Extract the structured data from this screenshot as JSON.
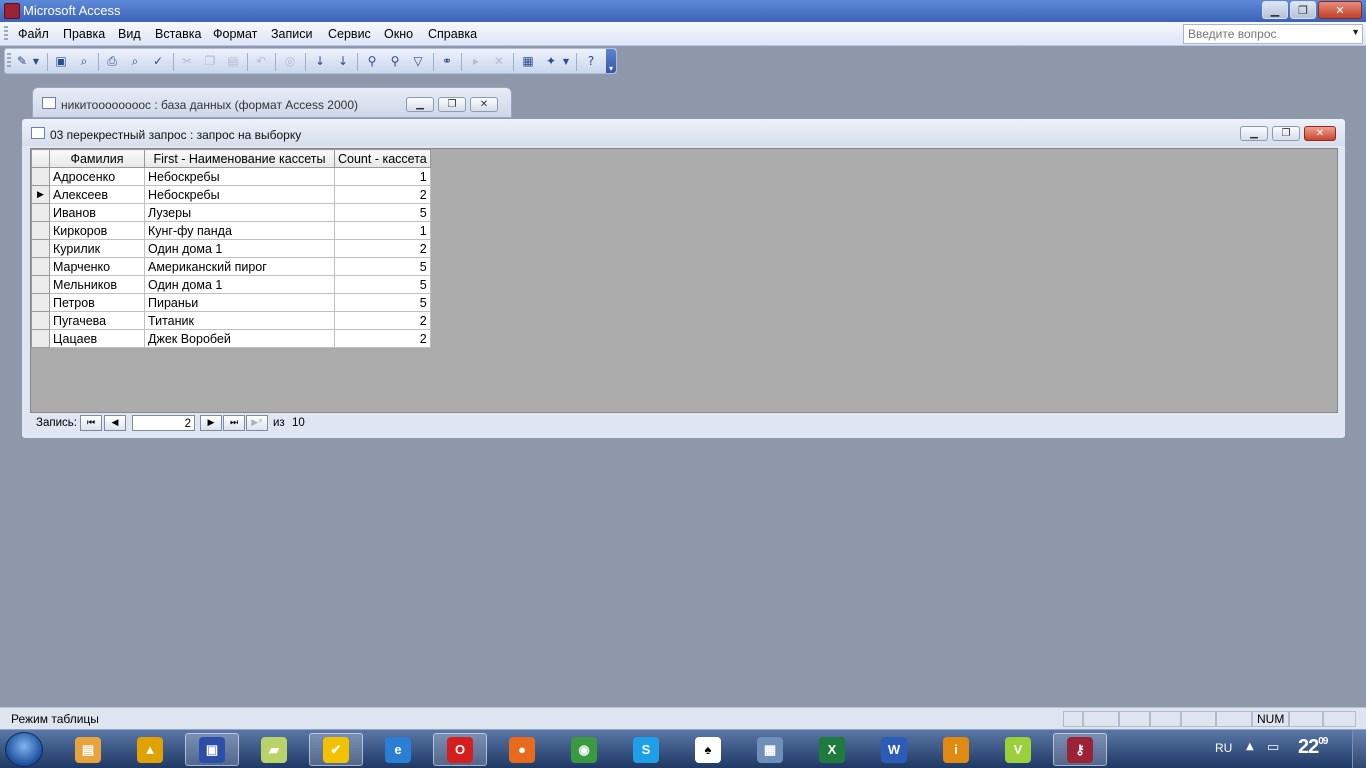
{
  "app": {
    "title": "Microsoft Access"
  },
  "menu": {
    "items": [
      "Файл",
      "Правка",
      "Вид",
      "Вставка",
      "Формат",
      "Записи",
      "Сервис",
      "Окно",
      "Справка"
    ],
    "help_placeholder": "Введите вопрос"
  },
  "toolbar": {
    "icons": [
      "view-design-icon",
      "dropdown-arrow-icon",
      "save-icon",
      "search-file-icon",
      "print-icon",
      "print-preview-icon",
      "spelling-icon",
      "cut-icon",
      "copy-icon",
      "paste-icon",
      "undo-icon",
      "hyperlink-icon",
      "sort-ascending-icon",
      "sort-descending-icon",
      "filter-by-selection-icon",
      "filter-by-form-icon",
      "apply-filter-icon",
      "find-icon",
      "new-record-icon",
      "delete-record-icon",
      "database-window-icon",
      "new-object-icon",
      "help-icon"
    ]
  },
  "db_window": {
    "title": "никитоооооооос : база данных (формат Access 2000)"
  },
  "query_window": {
    "title": "03 перекрестный запрос : запрос на выборку",
    "columns": [
      "Фамилия",
      "First - Наименование кассеты",
      "Count - кассета"
    ],
    "rows": [
      {
        "fam": "Адросенко",
        "name": "Небоскребы",
        "cnt": "1"
      },
      {
        "fam": "Алексеев",
        "name": "Небоскребы",
        "cnt": "2"
      },
      {
        "fam": "Иванов",
        "name": "Лузеры",
        "cnt": "5"
      },
      {
        "fam": "Киркоров",
        "name": "Кунг-фу панда",
        "cnt": "1"
      },
      {
        "fam": "Курилик",
        "name": "Один дома 1",
        "cnt": "2"
      },
      {
        "fam": "Марченко",
        "name": "Американский пирог",
        "cnt": "5"
      },
      {
        "fam": "Мельников",
        "name": "Один дома 1",
        "cnt": "5"
      },
      {
        "fam": "Петров",
        "name": "Пираньи",
        "cnt": "5"
      },
      {
        "fam": "Пугачева",
        "name": "Титаник",
        "cnt": "2"
      },
      {
        "fam": "Цацаев",
        "name": "Джек Воробей",
        "cnt": "2"
      }
    ],
    "current_row_index": 1,
    "nav": {
      "label": "Запись:",
      "current": "2",
      "of": "из",
      "total": "10"
    }
  },
  "status": {
    "text": "Режим таблицы",
    "num": "NUM"
  },
  "taskbar": {
    "lang": "RU",
    "clock": "22",
    "clock_min": "09",
    "apps": [
      {
        "name": "file-manager-icon",
        "color": "#e8a33c",
        "glyph": "▤"
      },
      {
        "name": "archiver-icon",
        "color": "#e0a200",
        "glyph": "▲"
      },
      {
        "name": "floppy-save-icon",
        "color": "#2b4fa8",
        "glyph": "▣"
      },
      {
        "name": "notes-icon",
        "color": "#b9d36b",
        "glyph": "▰"
      },
      {
        "name": "checkmark-app-icon",
        "color": "#f2c200",
        "glyph": "✔"
      },
      {
        "name": "internet-explorer-icon",
        "color": "#2a7fd4",
        "glyph": "e"
      },
      {
        "name": "opera-icon",
        "color": "#d51f1f",
        "glyph": "O"
      },
      {
        "name": "firefox-icon",
        "color": "#e86a1c",
        "glyph": "●"
      },
      {
        "name": "chrome-icon",
        "color": "#3a9a3f",
        "glyph": "◉"
      },
      {
        "name": "skype-icon",
        "color": "#1ea0e8",
        "glyph": "S"
      },
      {
        "name": "cards-game-icon",
        "color": "#ffffff",
        "glyph": "♠"
      },
      {
        "name": "calculator-icon",
        "color": "#6d8fb8",
        "glyph": "▦"
      },
      {
        "name": "excel-icon",
        "color": "#1e7b3d",
        "glyph": "X"
      },
      {
        "name": "word-icon",
        "color": "#2a5cb8",
        "glyph": "W"
      },
      {
        "name": "info-icon",
        "color": "#e08a12",
        "glyph": "i"
      },
      {
        "name": "vector-app-icon",
        "color": "#9ad03a",
        "glyph": "V"
      },
      {
        "name": "access-icon",
        "color": "#9b2335",
        "glyph": "⚷"
      }
    ]
  }
}
